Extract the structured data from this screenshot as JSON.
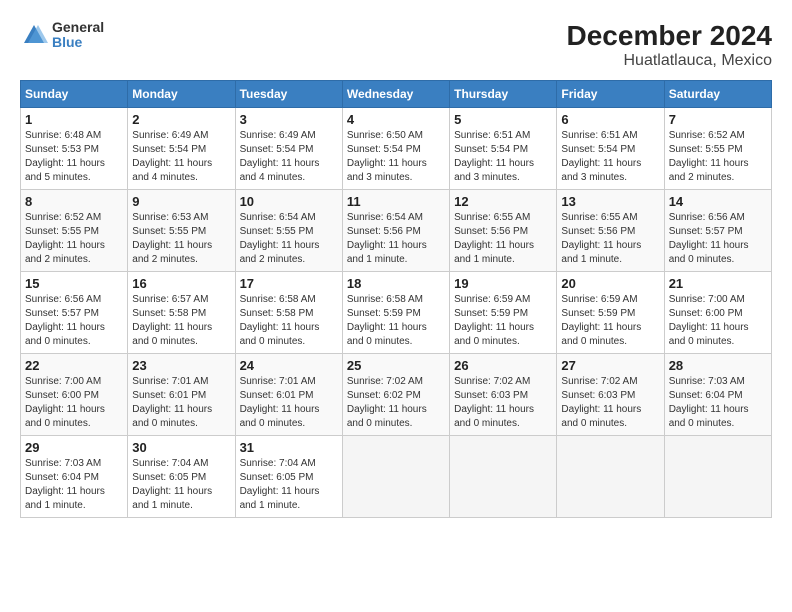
{
  "header": {
    "logo_line1": "General",
    "logo_line2": "Blue",
    "title": "December 2024",
    "subtitle": "Huatlatlauca, Mexico"
  },
  "calendar": {
    "days_of_week": [
      "Sunday",
      "Monday",
      "Tuesday",
      "Wednesday",
      "Thursday",
      "Friday",
      "Saturday"
    ],
    "weeks": [
      [
        {
          "day": "1",
          "sunrise": "6:48 AM",
          "sunset": "5:53 PM",
          "daylight": "11 hours and 5 minutes."
        },
        {
          "day": "2",
          "sunrise": "6:49 AM",
          "sunset": "5:54 PM",
          "daylight": "11 hours and 4 minutes."
        },
        {
          "day": "3",
          "sunrise": "6:49 AM",
          "sunset": "5:54 PM",
          "daylight": "11 hours and 4 minutes."
        },
        {
          "day": "4",
          "sunrise": "6:50 AM",
          "sunset": "5:54 PM",
          "daylight": "11 hours and 3 minutes."
        },
        {
          "day": "5",
          "sunrise": "6:51 AM",
          "sunset": "5:54 PM",
          "daylight": "11 hours and 3 minutes."
        },
        {
          "day": "6",
          "sunrise": "6:51 AM",
          "sunset": "5:54 PM",
          "daylight": "11 hours and 3 minutes."
        },
        {
          "day": "7",
          "sunrise": "6:52 AM",
          "sunset": "5:55 PM",
          "daylight": "11 hours and 2 minutes."
        }
      ],
      [
        {
          "day": "8",
          "sunrise": "6:52 AM",
          "sunset": "5:55 PM",
          "daylight": "11 hours and 2 minutes."
        },
        {
          "day": "9",
          "sunrise": "6:53 AM",
          "sunset": "5:55 PM",
          "daylight": "11 hours and 2 minutes."
        },
        {
          "day": "10",
          "sunrise": "6:54 AM",
          "sunset": "5:55 PM",
          "daylight": "11 hours and 2 minutes."
        },
        {
          "day": "11",
          "sunrise": "6:54 AM",
          "sunset": "5:56 PM",
          "daylight": "11 hours and 1 minute."
        },
        {
          "day": "12",
          "sunrise": "6:55 AM",
          "sunset": "5:56 PM",
          "daylight": "11 hours and 1 minute."
        },
        {
          "day": "13",
          "sunrise": "6:55 AM",
          "sunset": "5:56 PM",
          "daylight": "11 hours and 1 minute."
        },
        {
          "day": "14",
          "sunrise": "6:56 AM",
          "sunset": "5:57 PM",
          "daylight": "11 hours and 0 minutes."
        }
      ],
      [
        {
          "day": "15",
          "sunrise": "6:56 AM",
          "sunset": "5:57 PM",
          "daylight": "11 hours and 0 minutes."
        },
        {
          "day": "16",
          "sunrise": "6:57 AM",
          "sunset": "5:58 PM",
          "daylight": "11 hours and 0 minutes."
        },
        {
          "day": "17",
          "sunrise": "6:58 AM",
          "sunset": "5:58 PM",
          "daylight": "11 hours and 0 minutes."
        },
        {
          "day": "18",
          "sunrise": "6:58 AM",
          "sunset": "5:59 PM",
          "daylight": "11 hours and 0 minutes."
        },
        {
          "day": "19",
          "sunrise": "6:59 AM",
          "sunset": "5:59 PM",
          "daylight": "11 hours and 0 minutes."
        },
        {
          "day": "20",
          "sunrise": "6:59 AM",
          "sunset": "5:59 PM",
          "daylight": "11 hours and 0 minutes."
        },
        {
          "day": "21",
          "sunrise": "7:00 AM",
          "sunset": "6:00 PM",
          "daylight": "11 hours and 0 minutes."
        }
      ],
      [
        {
          "day": "22",
          "sunrise": "7:00 AM",
          "sunset": "6:00 PM",
          "daylight": "11 hours and 0 minutes."
        },
        {
          "day": "23",
          "sunrise": "7:01 AM",
          "sunset": "6:01 PM",
          "daylight": "11 hours and 0 minutes."
        },
        {
          "day": "24",
          "sunrise": "7:01 AM",
          "sunset": "6:01 PM",
          "daylight": "11 hours and 0 minutes."
        },
        {
          "day": "25",
          "sunrise": "7:02 AM",
          "sunset": "6:02 PM",
          "daylight": "11 hours and 0 minutes."
        },
        {
          "day": "26",
          "sunrise": "7:02 AM",
          "sunset": "6:03 PM",
          "daylight": "11 hours and 0 minutes."
        },
        {
          "day": "27",
          "sunrise": "7:02 AM",
          "sunset": "6:03 PM",
          "daylight": "11 hours and 0 minutes."
        },
        {
          "day": "28",
          "sunrise": "7:03 AM",
          "sunset": "6:04 PM",
          "daylight": "11 hours and 0 minutes."
        }
      ],
      [
        {
          "day": "29",
          "sunrise": "7:03 AM",
          "sunset": "6:04 PM",
          "daylight": "11 hours and 1 minute."
        },
        {
          "day": "30",
          "sunrise": "7:04 AM",
          "sunset": "6:05 PM",
          "daylight": "11 hours and 1 minute."
        },
        {
          "day": "31",
          "sunrise": "7:04 AM",
          "sunset": "6:05 PM",
          "daylight": "11 hours and 1 minute."
        },
        null,
        null,
        null,
        null
      ]
    ]
  }
}
